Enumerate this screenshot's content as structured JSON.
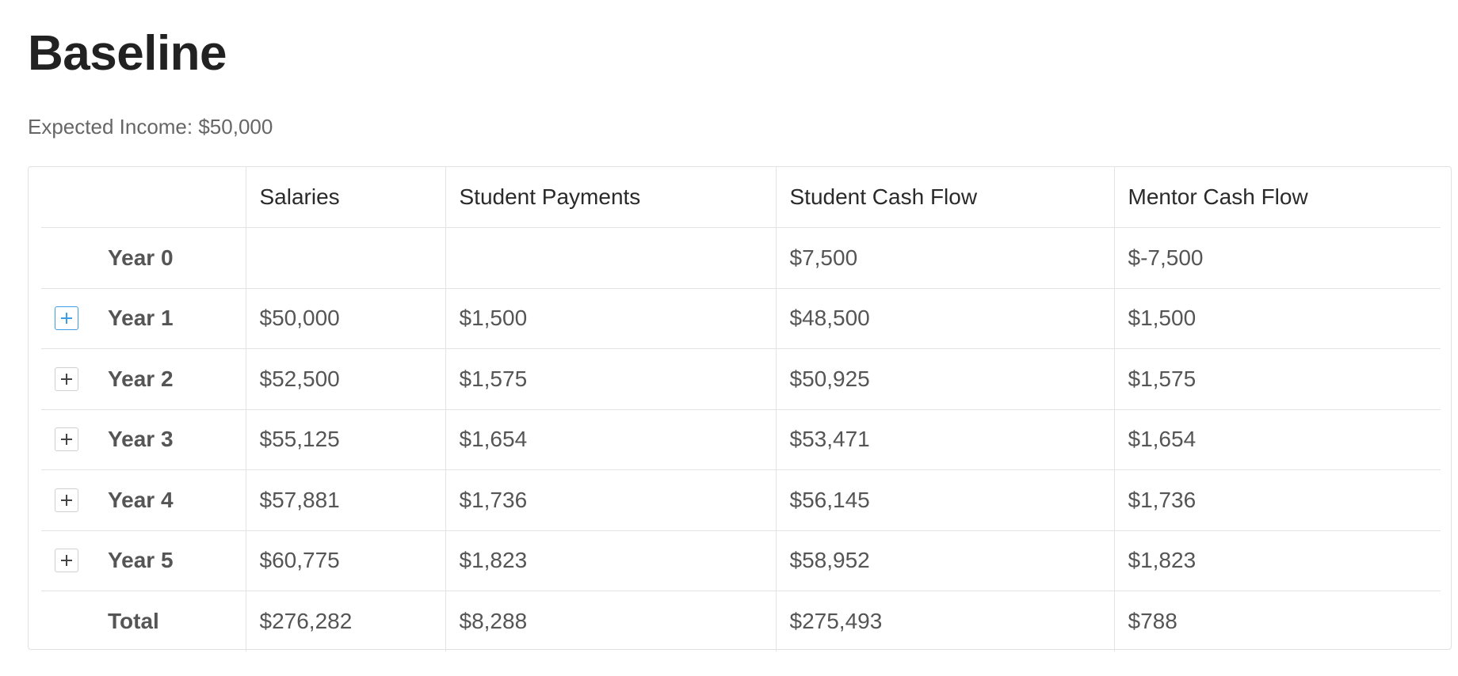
{
  "page": {
    "title": "Baseline",
    "subtitle": "Expected Income: $50,000"
  },
  "table": {
    "headers": [
      "",
      "Salaries",
      "Student Payments",
      "Student Cash Flow",
      "Mentor Cash Flow"
    ],
    "rows": [
      {
        "label": "Year 0",
        "expandable": false,
        "expanded_focus": false,
        "cells": [
          "",
          "",
          "$7,500",
          "$-7,500"
        ]
      },
      {
        "label": "Year 1",
        "expandable": true,
        "expanded_focus": true,
        "cells": [
          "$50,000",
          "$1,500",
          "$48,500",
          "$1,500"
        ]
      },
      {
        "label": "Year 2",
        "expandable": true,
        "expanded_focus": false,
        "cells": [
          "$52,500",
          "$1,575",
          "$50,925",
          "$1,575"
        ]
      },
      {
        "label": "Year 3",
        "expandable": true,
        "expanded_focus": false,
        "cells": [
          "$55,125",
          "$1,654",
          "$53,471",
          "$1,654"
        ]
      },
      {
        "label": "Year 4",
        "expandable": true,
        "expanded_focus": false,
        "cells": [
          "$57,881",
          "$1,736",
          "$56,145",
          "$1,736"
        ]
      },
      {
        "label": "Year 5",
        "expandable": true,
        "expanded_focus": false,
        "cells": [
          "$60,775",
          "$1,823",
          "$58,952",
          "$1,823"
        ]
      },
      {
        "label": "Total",
        "expandable": false,
        "expanded_focus": false,
        "cells": [
          "$276,282",
          "$8,288",
          "$275,493",
          "$788"
        ]
      }
    ]
  },
  "icons": {
    "expand": "plus-icon"
  },
  "colors": {
    "focus_accent": "#3d9ee6",
    "border": "#e3e3e3",
    "title": "#222222",
    "text": "#555555"
  }
}
